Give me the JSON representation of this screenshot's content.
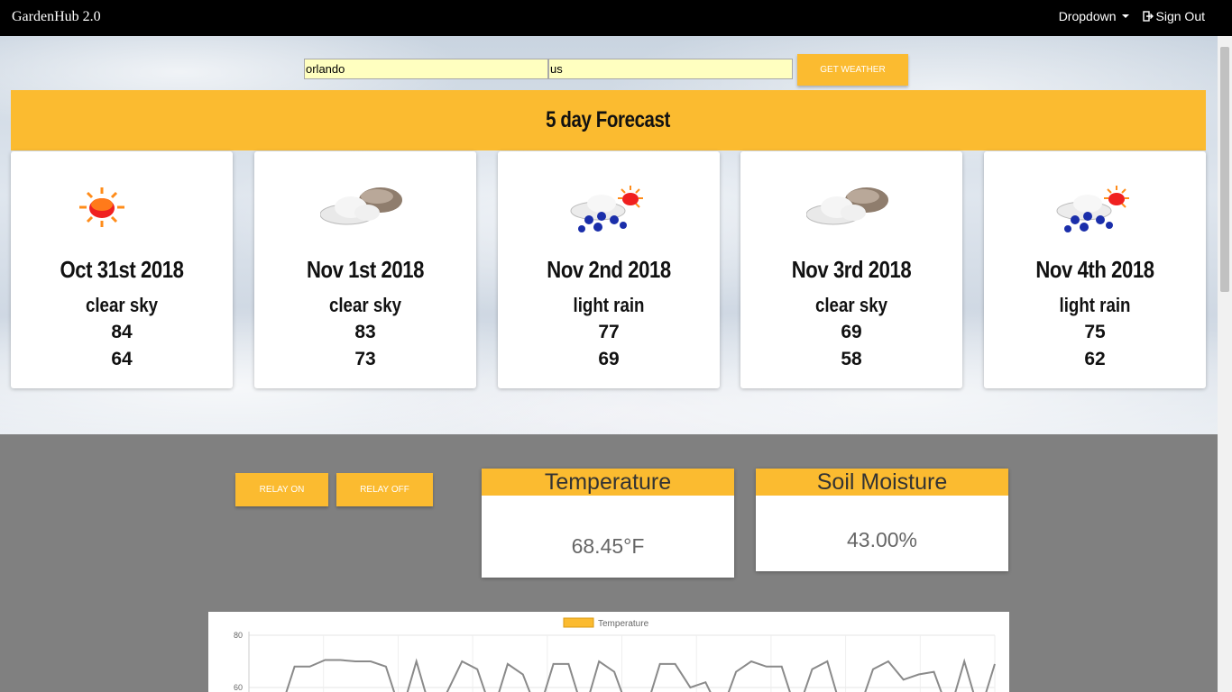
{
  "navbar": {
    "brand": "GardenHub 2.0",
    "dropdown_label": "Dropdown",
    "signout_label": "Sign Out"
  },
  "search": {
    "city_value": "orlando",
    "country_value": "us",
    "button_label": "GET WEATHER"
  },
  "forecast": {
    "title": "5 day Forecast",
    "days": [
      {
        "date": "Oct 31st 2018",
        "desc": "clear sky",
        "hi": "84",
        "lo": "64",
        "icon": "sun-icon"
      },
      {
        "date": "Nov 1st 2018",
        "desc": "clear sky",
        "hi": "83",
        "lo": "73",
        "icon": "cloud-moon-icon"
      },
      {
        "date": "Nov 2nd 2018",
        "desc": "light rain",
        "hi": "77",
        "lo": "69",
        "icon": "rain-sun-icon"
      },
      {
        "date": "Nov 3rd 2018",
        "desc": "clear sky",
        "hi": "69",
        "lo": "58",
        "icon": "cloud-moon-icon"
      },
      {
        "date": "Nov 4th 2018",
        "desc": "light rain",
        "hi": "75",
        "lo": "62",
        "icon": "rain-sun-icon"
      }
    ]
  },
  "controls": {
    "relay_on": "RELAY ON",
    "relay_off": "RELAY OFF"
  },
  "sensors": {
    "temperature": {
      "title": "Temperature",
      "value": "68.45°F"
    },
    "soil": {
      "title": "Soil Moisture",
      "value": "43.00%"
    }
  },
  "colors": {
    "accent": "#fbbb30",
    "navbar": "#000000",
    "background": "#808080"
  },
  "chart_data": {
    "type": "line",
    "legend": [
      "Temperature"
    ],
    "legend_placement": "top",
    "y_ticks": [
      80,
      60
    ],
    "grid": true,
    "series": [
      {
        "name": "Temperature",
        "values": [
          50,
          50,
          50,
          68,
          68,
          70.5,
          70.5,
          70,
          70,
          68,
          50,
          70,
          50,
          58,
          70,
          67,
          50,
          69,
          65,
          50,
          69,
          69,
          50,
          70,
          66,
          50,
          50,
          69,
          69,
          60,
          62,
          50,
          66,
          70,
          68,
          68,
          50,
          67,
          70,
          50,
          50,
          67,
          70,
          63,
          65,
          66,
          50,
          70,
          50,
          69
        ]
      }
    ]
  }
}
